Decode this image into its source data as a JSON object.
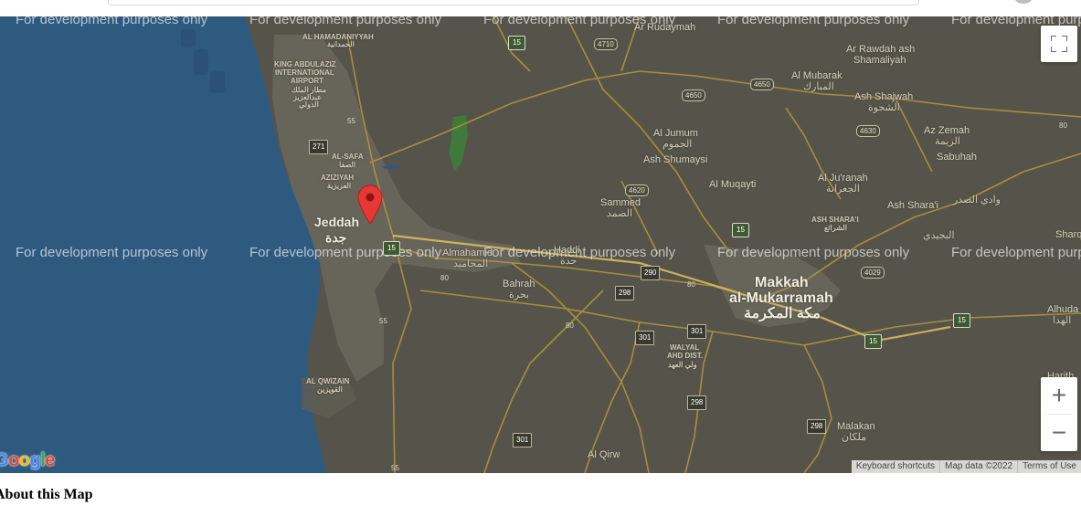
{
  "page": {
    "about_heading": "About this Map"
  },
  "map": {
    "watermark": "For development purposes only",
    "logo_letters": [
      "G",
      "o",
      "o",
      "g",
      "l",
      "e"
    ],
    "logo_colors": [
      "#4285F4",
      "#EA4335",
      "#FBBC05",
      "#4285F4",
      "#34A853",
      "#EA4335"
    ],
    "colors": {
      "sea": "#2e5a80",
      "land": "#56544a",
      "urban": "#6a675d",
      "road": "#b0953c",
      "marker": "#e53935"
    },
    "labels": {
      "al_hamadaniyyah": "AL HAMADANIYYAH",
      "al_hamadaniyyah_ar": "الحمدانية",
      "airport_1": "KING ABDULAZIZ",
      "airport_2": "INTERNATIONAL",
      "airport_3": "AIRPORT",
      "airport_ar_1": "مطار الملك",
      "airport_ar_2": "عبدالعزيز",
      "airport_ar_3": "الدولي",
      "al_safa": "AL-SAFA",
      "al_safa_ar": "الصفا",
      "aziziyah": "AZIZIYAH",
      "aziziyah_ar": "العزيزية",
      "jeddah": "Jeddah",
      "jeddah_ar": "جدة",
      "almahamid": "Almahamid",
      "almahamid_ar": "المحاميد",
      "haddi_ar": "حدة",
      "haddi": "Haddi",
      "bahrah": "Bahrah",
      "bahrah_ar": "بحرة",
      "ar_rudaymah": "Ar Rudaymah",
      "ar_rawdah_1": "Ar Rawdah ash",
      "ar_rawdah_2": "Shamaliyah",
      "al_mubarak": "Al Mubarak",
      "al_mubarak_ar": "المبارك",
      "ash_shajwah": "Ash Shajwah",
      "ash_shajwah_ar": "الشجوة",
      "az_zemah": "Az Zemah",
      "az_zemah_ar": "الزيمة",
      "sabuhah": "Sabuhah",
      "al_jumum": "Al Jumum",
      "al_jumum_ar": "الجموم",
      "ash_shumaysi": "Ash Shumaysi",
      "al_muqayti": "Al Muqayti",
      "al_juranah": "Al Ju'ranah",
      "al_juranah_ar": "الجعرانة",
      "ash_sharai": "Ash Shara'i",
      "wadi_sadr_ar": "وادي الصدر",
      "ash_sharai_caps": "ASH SHARA'I",
      "ash_sharai_caps_ar": "الشرائع",
      "sammed": "Sammed",
      "sammed_ar": "الصمد",
      "makkah_1": "Makkah",
      "makkah_2": "al-Mukarramah",
      "makkah_ar": "مكة المكرمة",
      "sharq": "Sharq",
      "bujaydi_ar": "البجيدي",
      "alhuda": "Alhuda",
      "alhuda_ar": "الهدا",
      "harith": "Harith",
      "walyal_1": "WALYAL",
      "walyal_2": "AHD DIST.",
      "walyal_ar": "ولي العهد",
      "al_qwizain": "AL QWIZAIN",
      "al_qwizain_ar": "القويزين",
      "malakan": "Malakan",
      "malakan_ar": "ملكان",
      "al_qirw": "Al Qirw"
    },
    "shields": {
      "r15_a": "15",
      "r4710": "4710",
      "r4650_a": "4650",
      "r4650_b": "4650",
      "r4630": "4630",
      "r4620": "4620",
      "r4029": "4029",
      "r271": "271",
      "r55_a": "55",
      "r55_b": "55",
      "r55_c": "55",
      "r80_a": "80",
      "r80_b": "80",
      "r80_c": "80",
      "r80_d": "80",
      "r290": "290",
      "r298_a": "298",
      "r298_b": "298",
      "r298_c": "298",
      "r301_a": "301",
      "r301_b": "301",
      "r301_c": "301",
      "r15_b": "15",
      "r15_c": "15",
      "r15_d": "15",
      "r15_e": "15"
    },
    "controls": {
      "fullscreen_icon": "fullscreen-icon",
      "zoom_in": "+",
      "zoom_out": "−"
    },
    "footer": {
      "keyboard_shortcuts": "Keyboard shortcuts",
      "map_data": "Map data ©2022",
      "terms": "Terms of Use"
    }
  }
}
